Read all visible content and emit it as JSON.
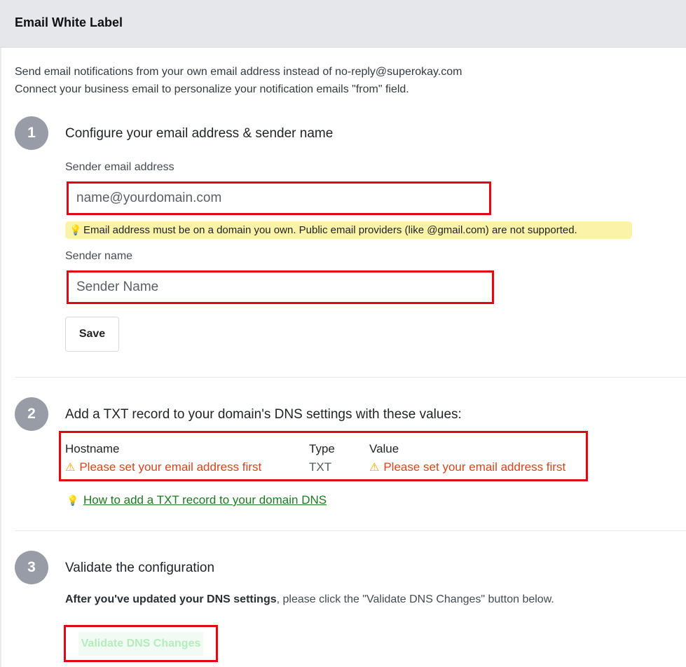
{
  "header": {
    "title": "Email White Label"
  },
  "intro": {
    "line1": "Send email notifications from your own email address instead of no-reply@superokay.com",
    "line2": "Connect your business email to personalize your notification emails \"from\" field."
  },
  "step1": {
    "number": "1",
    "title": "Configure your email address & sender name",
    "email_label": "Sender email address",
    "email_placeholder": "name@yourdomain.com",
    "email_value": "",
    "tip": "Email address must be on a domain you own. Public email providers (like @gmail.com) are not supported.",
    "sender_label": "Sender name",
    "sender_placeholder": "Sender Name",
    "sender_value": "",
    "save_label": "Save"
  },
  "step2": {
    "number": "2",
    "title": "Add a TXT record to your domain's DNS settings with these values:",
    "columns": [
      "Hostname",
      "Type",
      "Value"
    ],
    "row": {
      "hostname": "Please set your email address first",
      "type": "TXT",
      "value": "Please set your email address first"
    },
    "howto_link": "How to add a TXT record to your domain DNS"
  },
  "step3": {
    "number": "3",
    "title": "Validate the configuration",
    "desc_bold": "After you've updated your DNS settings",
    "desc_rest": ", please click the \"Validate DNS Changes\" button below.",
    "validate_label": "Validate DNS Changes"
  },
  "icons": {
    "tip": "lightbulb-icon",
    "warning": "warning-icon",
    "howto": "lightbulb-icon"
  },
  "colors": {
    "accent_red": "#e30613",
    "warning_text": "#d8451b",
    "link_green": "#1b7a1f",
    "tip_bg": "#fbf4a8",
    "step_circle": "#979ca6"
  }
}
